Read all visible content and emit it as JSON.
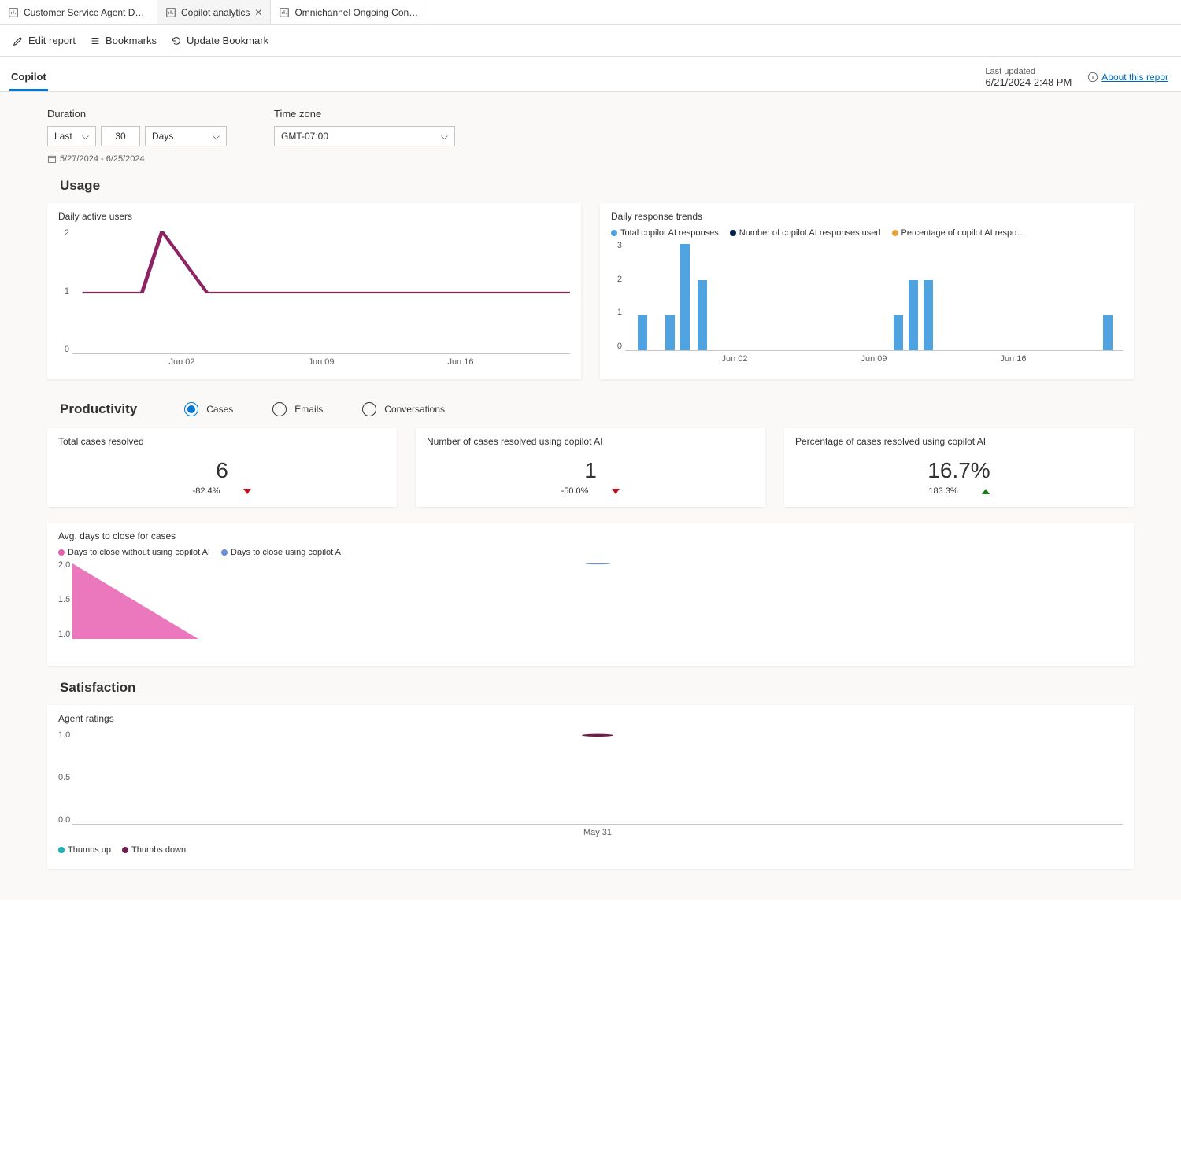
{
  "tabs": [
    {
      "label": "Customer Service Agent Dash…"
    },
    {
      "label": "Copilot analytics"
    },
    {
      "label": "Omnichannel Ongoing Conve…"
    }
  ],
  "toolbar": {
    "edit": "Edit report",
    "bookmarks": "Bookmarks",
    "update": "Update Bookmark"
  },
  "page_tab": "Copilot",
  "last_updated_label": "Last updated",
  "last_updated_value": "6/21/2024 2:48 PM",
  "about_link": "About this repor",
  "filters": {
    "duration_label": "Duration",
    "last": "Last",
    "count": "30",
    "unit": "Days",
    "date_range": "5/27/2024 - 6/25/2024",
    "timezone_label": "Time zone",
    "timezone_value": "GMT-07:00"
  },
  "sections": {
    "usage": "Usage",
    "productivity": "Productivity",
    "satisfaction": "Satisfaction"
  },
  "usage": {
    "dau_title": "Daily active users",
    "dau_ymax": "2",
    "dau_ymid": "1",
    "dau_ymin": "0",
    "drt_title": "Daily response trends",
    "drt_legend": [
      "Total copilot AI responses",
      "Number of copilot AI responses used",
      "Percentage of copilot AI respo…"
    ],
    "drt_y": [
      "3",
      "2",
      "1",
      "0"
    ],
    "xt": [
      "Jun 02",
      "Jun 09",
      "Jun 16"
    ]
  },
  "productivity_radios": [
    "Cases",
    "Emails",
    "Conversations"
  ],
  "kpis": [
    {
      "title": "Total cases resolved",
      "value": "6",
      "delta": "-82.4%",
      "dir": "down"
    },
    {
      "title": "Number of cases resolved using copilot AI",
      "value": "1",
      "delta": "-50.0%",
      "dir": "down"
    },
    {
      "title": "Percentage of cases resolved using copilot AI",
      "value": "16.7%",
      "delta": "183.3%",
      "dir": "up"
    }
  ],
  "avgdays": {
    "title": "Avg. days to close for cases",
    "legend": [
      "Days to close without using copilot AI",
      "Days to close using copilot AI"
    ],
    "y": [
      "2.0",
      "1.5",
      "1.0"
    ]
  },
  "agent": {
    "title": "Agent ratings",
    "y": [
      "1.0",
      "0.5",
      "0.0"
    ],
    "xt": "May 31",
    "legend": [
      "Thumbs up",
      "Thumbs down"
    ]
  },
  "chart_data": [
    {
      "type": "line",
      "title": "Daily active users",
      "ylim": [
        0,
        2
      ],
      "x_ticks": [
        "Jun 02",
        "Jun 09",
        "Jun 16"
      ],
      "series": [
        {
          "name": "Daily active users",
          "values": [
            1,
            1,
            1,
            2,
            1,
            1,
            1,
            1,
            1,
            1,
            1,
            1,
            1,
            1,
            1,
            1,
            1,
            1,
            1,
            1,
            1,
            1,
            1,
            1
          ]
        }
      ]
    },
    {
      "type": "bar",
      "title": "Daily response trends",
      "ylim": [
        0,
        3
      ],
      "x_ticks": [
        "Jun 02",
        "Jun 09",
        "Jun 16"
      ],
      "series": [
        {
          "name": "Total copilot AI responses",
          "sparse": [
            [
              0,
              1
            ],
            [
              2,
              1
            ],
            [
              3,
              3
            ],
            [
              4,
              2
            ],
            [
              16,
              1
            ],
            [
              17,
              2
            ],
            [
              18,
              2
            ],
            [
              29,
              1
            ]
          ]
        },
        {
          "name": "Number of copilot AI responses used",
          "sparse": []
        },
        {
          "name": "Percentage of copilot AI responses used",
          "sparse": []
        }
      ]
    },
    {
      "type": "area",
      "title": "Avg. days to close for cases",
      "ylim": [
        0.5,
        2.0
      ],
      "series": [
        {
          "name": "Days to close without using copilot AI",
          "points": [
            [
              0,
              2.0
            ],
            [
              0.1,
              0.5
            ]
          ]
        },
        {
          "name": "Days to close using copilot AI",
          "points": [
            [
              0.5,
              2.0
            ]
          ]
        }
      ]
    },
    {
      "type": "scatter",
      "title": "Agent ratings",
      "ylim": [
        0.0,
        1.0
      ],
      "x_ticks": [
        "May 31"
      ],
      "series": [
        {
          "name": "Thumbs up",
          "points": []
        },
        {
          "name": "Thumbs down",
          "points": [
            [
              "May 31",
              1.0
            ]
          ]
        }
      ]
    }
  ]
}
